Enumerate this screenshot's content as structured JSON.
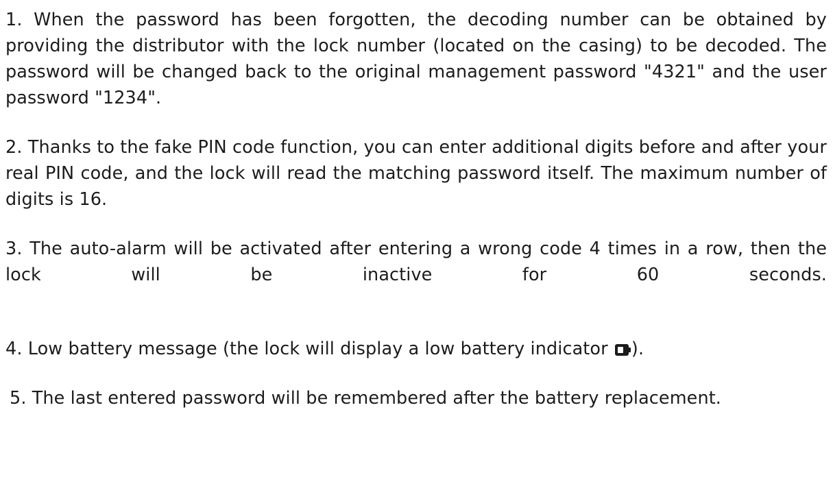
{
  "instructions": {
    "item1": "1. When the password has been forgotten, the decoding number can be obtained by providing the distributor with the lock number (located on the casing) to be decoded. The password will be changed back to the original management password \"4321\" and the user password \"1234\".",
    "item2": "2. Thanks to the fake PIN code function, you can enter additional digits before and after your real PIN code, and the lock will read the matching password itself. The maximum number of digits is 16.",
    "item3": "3. The auto-alarm will be activated after entering a wrong code 4 times in a row, then the lock will be inactive for 60 seconds.",
    "item4_before_icon": "4. Low battery message (the lock will display a low battery indicator",
    "item4_icon": "battery-low-icon",
    "item4_after_icon": ").",
    "item5": "5. The last entered password will be remembered after the battery replacement."
  }
}
